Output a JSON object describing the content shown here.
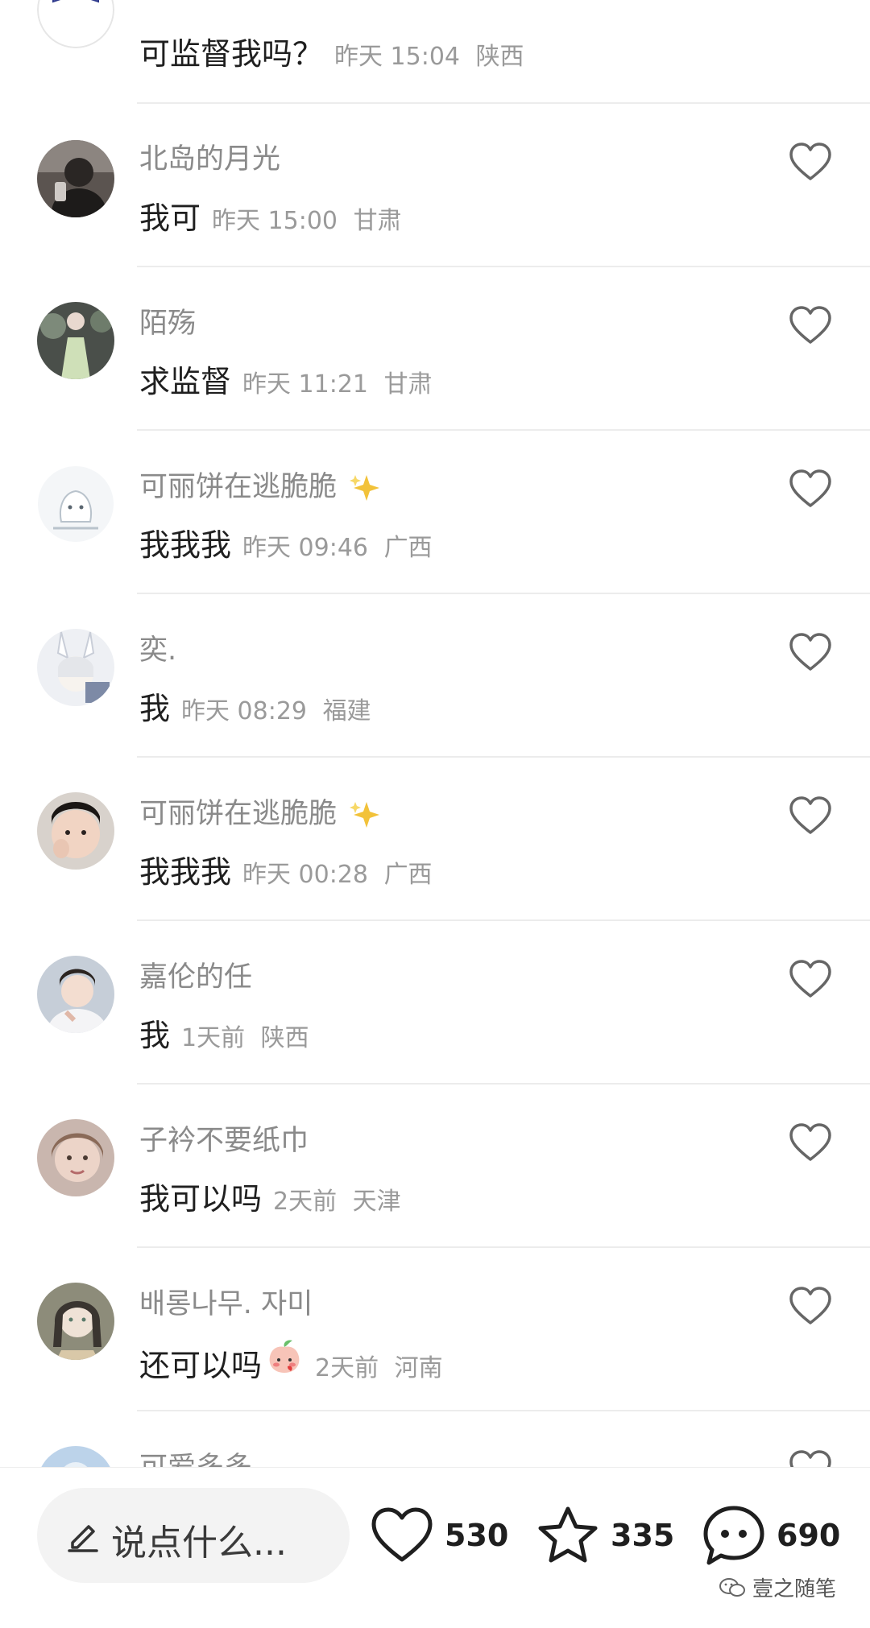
{
  "comments": [
    {
      "username": "",
      "text": "可监督我吗？",
      "time": "昨天 15:04",
      "location": "陕西",
      "avatar": "bow-logo-avatar"
    },
    {
      "username": "北岛的月光",
      "text": "我可",
      "time": "昨天 15:00",
      "location": "甘肃",
      "avatar": "user-photo-avatar"
    },
    {
      "username": "陌殇",
      "text": "求监督",
      "time": "昨天 11:21",
      "location": "甘肃",
      "avatar": "user-photo-avatar"
    },
    {
      "username": "可丽饼在逃脆脆",
      "text": "我我我",
      "time": "昨天 09:46",
      "location": "广西",
      "avatar": "cartoon-avatar",
      "badge": "sparkles-emoji"
    },
    {
      "username": "奕.",
      "text": "我",
      "time": "昨天 08:29",
      "location": "福建",
      "avatar": "anime-avatar"
    },
    {
      "username": "可丽饼在逃脆脆",
      "text": "我我我",
      "time": "昨天 00:28",
      "location": "广西",
      "avatar": "user-photo-avatar",
      "badge": "sparkles-emoji"
    },
    {
      "username": "嘉伦的任",
      "text": "我",
      "time": "1天前",
      "location": "陕西",
      "avatar": "user-photo-avatar"
    },
    {
      "username": "子衿不要纸巾",
      "text": "我可以吗",
      "time": "2天前",
      "location": "天津",
      "avatar": "user-photo-avatar"
    },
    {
      "username": "배롱나무. 자미",
      "text": "还可以吗",
      "time": "2天前",
      "location": "河南",
      "avatar": "illustration-avatar",
      "emoji": "blushing-peach-emoji"
    },
    {
      "username": "可爱多多",
      "text": "",
      "time": "",
      "location": "",
      "avatar": "user-photo-avatar"
    }
  ],
  "bottom_bar": {
    "input_placeholder": "说点什么...",
    "like_count": "530",
    "favorite_count": "335",
    "comment_count": "690"
  },
  "watermark": "壹之随笔",
  "icons": [
    "heart-icon",
    "star-icon",
    "chat-bubble-icon",
    "pencil-icon",
    "wechat-icon"
  ],
  "colors": {
    "text_primary": "#1f1f1f",
    "text_secondary": "#8a8a8a",
    "divider": "#ececec",
    "input_bg": "#f3f3f3",
    "sparkle": "#f2c23a"
  }
}
